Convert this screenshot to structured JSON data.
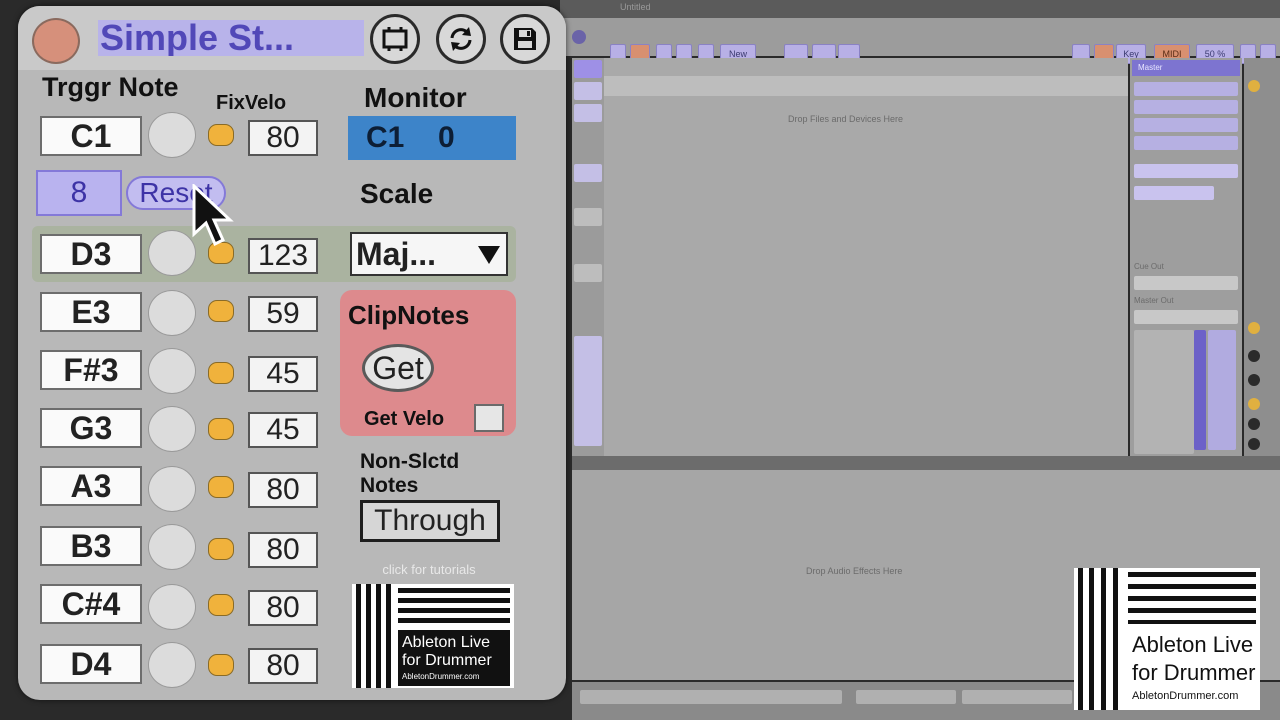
{
  "background": {
    "window_title": "Untitled",
    "toolbar_chips": [
      "New",
      "Key",
      "MIDI",
      "50 %"
    ],
    "session_drop_hint": "Drop Files and Devices Here",
    "device_drop_hint": "Drop Audio Effects Here",
    "master_label": "Master",
    "cue_out_label": "Cue Out",
    "master_out_label": "Master Out"
  },
  "plugin": {
    "title": "Simple St...",
    "trigger_note_label": "Trggr Note",
    "fix_velo_label": "FixVelo",
    "monitor_label": "Monitor",
    "monitor_note": "C1",
    "monitor_value": "0",
    "octave_value": "8",
    "reset_label": "Reset",
    "scale_label": "Scale",
    "scale_value": "Maj...",
    "clip_notes_label": "ClipNotes",
    "get_label": "Get",
    "get_velo_label": "Get Velo",
    "non_selected_line1": "Non-Slctd",
    "non_selected_line2": "Notes",
    "through_label": "Through",
    "tutorials_link": "click for tutorials",
    "rows": [
      {
        "note": "C1",
        "velo": "80"
      },
      {
        "note": "D3",
        "velo": "123"
      },
      {
        "note": "E3",
        "velo": "59"
      },
      {
        "note": "F#3",
        "velo": "45"
      },
      {
        "note": "G3",
        "velo": "45"
      },
      {
        "note": "A3",
        "velo": "80"
      },
      {
        "note": "B3",
        "velo": "80"
      },
      {
        "note": "C#4",
        "velo": "80"
      },
      {
        "note": "D4",
        "velo": "80"
      }
    ]
  },
  "logo": {
    "line1": "Ableton Live",
    "line2": "for Drummer",
    "site": "AbletonDrummer.com"
  },
  "colors": {
    "accent_purple": "#5148b8",
    "monitor_blue": "#3d84c9",
    "clip_red": "#dd8a8d",
    "led_orange": "#f0b23c"
  }
}
